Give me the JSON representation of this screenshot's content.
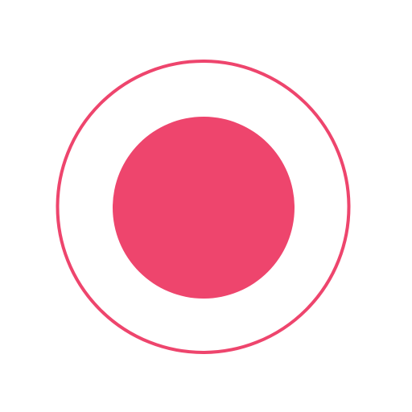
{
  "icon": {
    "name": "record-icon",
    "accent_color": "#ee456d",
    "background_color": "#ffffff"
  }
}
